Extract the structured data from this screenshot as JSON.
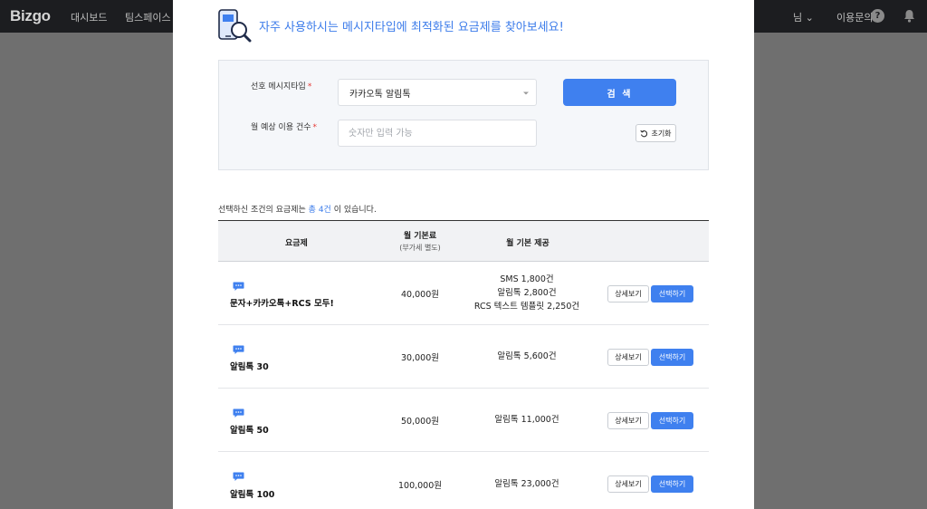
{
  "app": {
    "logo": "Bizgo",
    "nav": [
      "대시보드",
      "팀스페이스 ⌄"
    ],
    "user_label": "님 ⌄",
    "inquiry_label": "이용문의",
    "help_label": "?"
  },
  "modal": {
    "title": "자주 사용하시는 메시지타입에 최적화된 요금제를 찾아보세요!",
    "search": {
      "type_label": "선호 메시지타입",
      "type_value": "카카오톡 알림톡",
      "count_label": "월 예상 이용 건수",
      "count_placeholder": "숫자만 입력 가능",
      "required_mark": "*",
      "search_button": "검 색",
      "reset_button": "초기화"
    },
    "summary": {
      "prefix": "선택하신 조건의 요금제는 ",
      "count": "총 4건",
      "suffix": " 이 있습니다."
    },
    "table": {
      "headers": {
        "plan": "요금제",
        "fee": "월 기본료",
        "fee_note": "(부가세 별도)",
        "provide": "월 기본 제공"
      },
      "detail_label": "상세보기",
      "select_label": "선택하기",
      "rows": [
        {
          "name": "문자+카카오톡+RCS 모두!",
          "price": "40,000원",
          "provide": [
            "SMS 1,800건",
            "알림톡 2,800건",
            "RCS 텍스트 템플릿 2,250건"
          ]
        },
        {
          "name": "알림톡 30",
          "price": "30,000원",
          "provide": [
            "알림톡 5,600건"
          ]
        },
        {
          "name": "알림톡 50",
          "price": "50,000원",
          "provide": [
            "알림톡 11,000건"
          ]
        },
        {
          "name": "알림톡 100",
          "price": "100,000원",
          "provide": [
            "알림톡 23,000건"
          ]
        }
      ]
    }
  },
  "colors": {
    "accent": "#3f80ef",
    "overlay": "#6f6f6f",
    "nav": "#1c1d20"
  }
}
